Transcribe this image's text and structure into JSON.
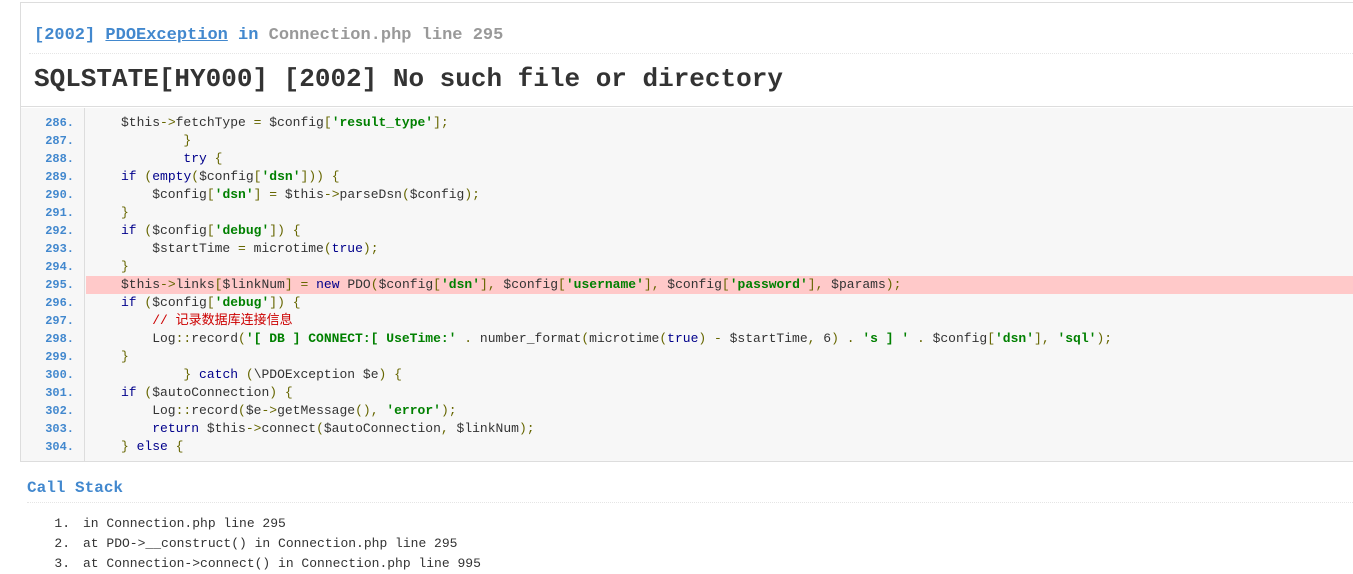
{
  "header": {
    "code": "[2002]",
    "exception": "PDOException",
    "in_word": "in",
    "file": "Connection.php line 295",
    "message": "SQLSTATE[HY000] [2002] No such file or directory"
  },
  "source": {
    "highlight_line": "295.",
    "lines": [
      {
        "num": "286.",
        "text": "            $this->fetchType = $config['result_type'];"
      },
      {
        "num": "287.",
        "text": "        }"
      },
      {
        "num": "288.",
        "text": "        try {"
      },
      {
        "num": "289.",
        "text": "            if (empty($config['dsn'])) {"
      },
      {
        "num": "290.",
        "text": "                $config['dsn'] = $this->parseDsn($config);"
      },
      {
        "num": "291.",
        "text": "            }"
      },
      {
        "num": "292.",
        "text": "            if ($config['debug']) {"
      },
      {
        "num": "293.",
        "text": "                $startTime = microtime(true);"
      },
      {
        "num": "294.",
        "text": "            }"
      },
      {
        "num": "295.",
        "text": "            $this->links[$linkNum] = new PDO($config['dsn'], $config['username'], $config['password'], $params);"
      },
      {
        "num": "296.",
        "text": "            if ($config['debug']) {"
      },
      {
        "num": "297.",
        "text": "                // 记录数据库连接信息"
      },
      {
        "num": "298.",
        "text": "                Log::record('[ DB ] CONNECT:[ UseTime:' . number_format(microtime(true) - $startTime, 6) . 's ] ' . $config['dsn'], 'sql');"
      },
      {
        "num": "299.",
        "text": "            }"
      },
      {
        "num": "300.",
        "text": "        } catch (\\PDOException $e) {"
      },
      {
        "num": "301.",
        "text": "            if ($autoConnection) {"
      },
      {
        "num": "302.",
        "text": "                Log::record($e->getMessage(), 'error');"
      },
      {
        "num": "303.",
        "text": "                return $this->connect($autoConnection, $linkNum);"
      },
      {
        "num": "304.",
        "text": "            } else {"
      }
    ]
  },
  "call_stack": {
    "title": "Call Stack",
    "items": [
      {
        "num": "1.",
        "text": "in Connection.php line 295"
      },
      {
        "num": "2.",
        "text": "at PDO->__construct() in Connection.php line 295"
      },
      {
        "num": "3.",
        "text": "at Connection->connect() in Connection.php line 995"
      }
    ]
  },
  "colors": {
    "accent": "#4288ce",
    "highlight": "#ffc9c9",
    "code_bg": "#f7f7f7",
    "string": "#008000",
    "keyword": "#00008b"
  }
}
